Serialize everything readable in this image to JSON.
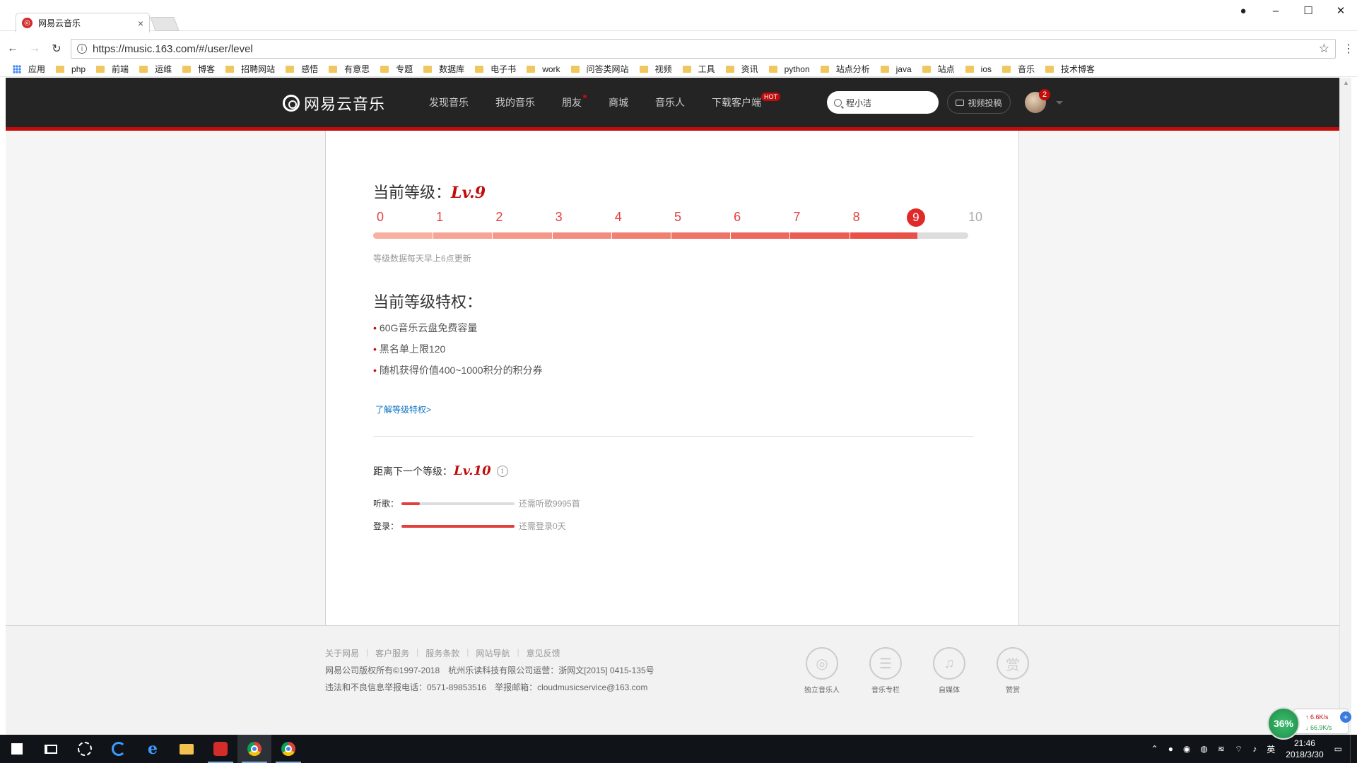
{
  "browser": {
    "tab_title": "网易云音乐",
    "tab_close": "×",
    "url": "https://music.163.com/#/user/level",
    "bookmarks": [
      "应用",
      "php",
      "前端",
      "运维",
      "博客",
      "招聘网站",
      "感悟",
      "有意思",
      "专题",
      "数据库",
      "电子书",
      "work",
      "问答类网站",
      "视频",
      "工具",
      "资讯",
      "python",
      "站点分析",
      "java",
      "站点",
      "ios",
      "音乐",
      "技术博客"
    ]
  },
  "site": {
    "logo": "网易云音乐",
    "nav": [
      "发现音乐",
      "我的音乐",
      "朋友",
      "商城",
      "音乐人",
      "下载客户端"
    ],
    "hot_badge": "HOT",
    "search_value": "程小洁",
    "upload_label": "视频投稿",
    "notification_count": "2"
  },
  "level": {
    "current_label": "当前等级：",
    "current_lv": "Lv.9",
    "ticks": [
      "0",
      "1",
      "2",
      "3",
      "4",
      "5",
      "6",
      "7",
      "8",
      "9",
      "10"
    ],
    "current_index": 9,
    "progress_fraction": 0.915,
    "colors": [
      "#f8b0a0",
      "#f6a495",
      "#f59889",
      "#f38c7e",
      "#f18073",
      "#ef7468",
      "#ed685d",
      "#eb5c52",
      "#e95047"
    ],
    "update_note": "等级数据每天早上6点更新",
    "privileges_title": "当前等级特权：",
    "privileges": [
      "60G音乐云盘免费容量",
      "黑名单上限120",
      "随机获得价值400~1000积分的积分券"
    ],
    "more_link": "了解等级特权>",
    "next_label": "距离下一个等级：",
    "next_lv": "Lv.10",
    "info_icon": "i",
    "progress": [
      {
        "label": "听歌：",
        "fraction": 0.16,
        "hint": "还需听歌9995首"
      },
      {
        "label": "登录：",
        "fraction": 1.0,
        "hint": "还需登录0天"
      }
    ]
  },
  "footer": {
    "links": [
      "关于网易",
      "客户服务",
      "服务条款",
      "网站导航",
      "意见反馈"
    ],
    "line2": "网易公司版权所有©1997-2018　杭州乐读科技有限公司运营：浙网文[2015] 0415-135号",
    "line3": "违法和不良信息举报电话：0571-89853516　举报邮箱：cloudmusicservice@163.com",
    "icons": [
      {
        "label": "独立音乐人",
        "glyph": "◎"
      },
      {
        "label": "音乐专栏",
        "glyph": "☰"
      },
      {
        "label": "自媒体",
        "glyph": "♫"
      },
      {
        "label": "赞赏",
        "glyph": "赏"
      }
    ]
  },
  "speed_monitor": {
    "percent": "36%",
    "up": "6.6K/s",
    "down": "66.9K/s"
  },
  "taskbar": {
    "time": "21:46",
    "date": "2018/3/30",
    "ime": "英"
  }
}
